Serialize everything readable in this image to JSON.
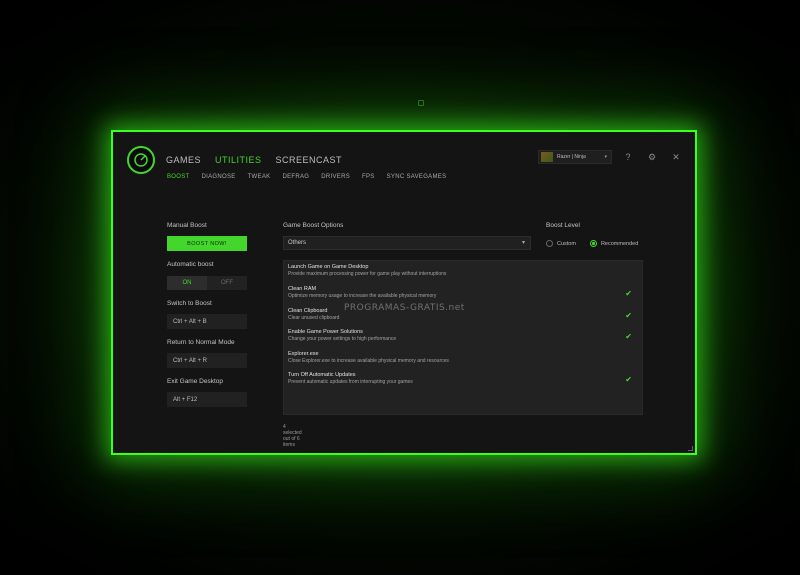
{
  "nav": {
    "tabs": [
      {
        "label": "GAMES",
        "active": false
      },
      {
        "label": "UTILITIES",
        "active": true
      },
      {
        "label": "SCREENCAST",
        "active": false
      }
    ],
    "subtabs": [
      {
        "label": "BOOST",
        "active": true
      },
      {
        "label": "DIAGNOSE",
        "active": false
      },
      {
        "label": "TWEAK",
        "active": false
      },
      {
        "label": "DEFRAG",
        "active": false
      },
      {
        "label": "DRIVERS",
        "active": false
      },
      {
        "label": "FPS",
        "active": false
      },
      {
        "label": "SYNC SAVEGAMES",
        "active": false
      }
    ]
  },
  "profile": {
    "name": "Razer | Ninja",
    "caret": "▾"
  },
  "window_icons": {
    "help": "?",
    "settings": "⚙",
    "close": "✕"
  },
  "left": {
    "manual_boost_label": "Manual Boost",
    "boost_button": "BOOST NOW!",
    "automatic_boost_label": "Automatic boost",
    "toggle_on": "ON",
    "toggle_off": "OFF",
    "switch_label": "Switch to Boost",
    "switch_hotkey": "Ctrl + Alt + B",
    "return_label": "Return to Normal Mode",
    "return_hotkey": "Ctrl + Alt + R",
    "exit_label": "Exit Game Desktop",
    "exit_hotkey": "Alt + F12"
  },
  "middle": {
    "options_label": "Game Boost Options",
    "select_value": "Others",
    "select_caret": "▾",
    "watermark": "PROGRAMAS-GRATIS.net",
    "items": [
      {
        "title": "Launch Game on Game Desktop",
        "desc": "Provide maximum processing power for game play without interruptions",
        "checked": false,
        "check": ""
      },
      {
        "title": "Clean RAM",
        "desc": "Optimize memory usage to increase the available physical memory",
        "checked": true,
        "check": "✔"
      },
      {
        "title": "Clean Clipboard",
        "desc": "Clear unused clipboard",
        "checked": true,
        "check": "✔"
      },
      {
        "title": "Enable Game Power Solutions",
        "desc": "Change your power settings to high performance",
        "checked": true,
        "check": "✔"
      },
      {
        "title": "Explorer.exe",
        "desc": "Close Explorer.exe to increase available physical memory and resources",
        "checked": false,
        "check": ""
      },
      {
        "title": "Turn Off Automatic Updates",
        "desc": "Prevent automatic updates from interrupting your games",
        "checked": true,
        "check": "✔"
      }
    ],
    "count_text": "4 selected out of 6 items"
  },
  "right": {
    "level_label": "Boost Level",
    "custom": "Custom",
    "recommended": "Recommended",
    "selected": "Recommended"
  },
  "colors": {
    "accent": "#44d62c",
    "window_bg": "#141414"
  }
}
